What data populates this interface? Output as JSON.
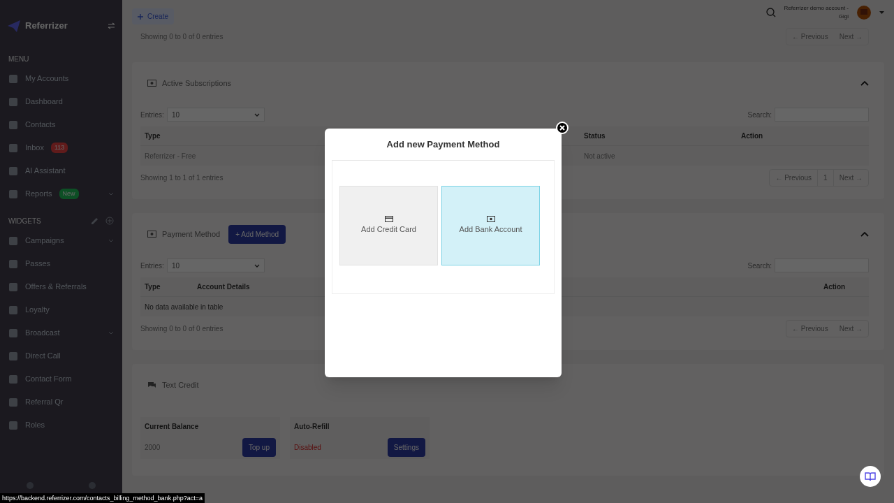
{
  "sidebar": {
    "brand": "Referrizer",
    "sections": [
      {
        "heading": "MENU",
        "items": [
          {
            "label": "My Accounts",
            "expandable": false
          },
          {
            "label": "Dashboard",
            "expandable": false
          },
          {
            "label": "Contacts",
            "expandable": false
          },
          {
            "label": "Inbox",
            "expandable": false,
            "badge": {
              "text": "113",
              "kind": "alert"
            }
          },
          {
            "label": "AI Assistant",
            "expandable": false
          },
          {
            "label": "Reports",
            "expandable": true,
            "badge": {
              "text": "New",
              "kind": "new"
            }
          }
        ]
      },
      {
        "heading": "WIDGETS",
        "items": [
          {
            "label": "Campaigns",
            "expandable": true
          },
          {
            "label": "Passes",
            "expandable": false
          },
          {
            "label": "Offers & Referrals",
            "expandable": false
          },
          {
            "label": "Loyalty",
            "expandable": false
          },
          {
            "label": "Broadcast",
            "expandable": true
          },
          {
            "label": "Direct Call",
            "expandable": false
          },
          {
            "label": "Contact Form",
            "expandable": false
          },
          {
            "label": "Referral Qr",
            "expandable": false
          },
          {
            "label": "Roles",
            "expandable": false
          }
        ]
      }
    ]
  },
  "topbar": {
    "account": "Referrizer demo account -",
    "user": "Gigi"
  },
  "create_button": "Create",
  "top_info": "Showing 0 to 0 of 0 entries",
  "top_pagination": {
    "previous": "← Previous",
    "next": "Next →"
  },
  "subscriptions": {
    "title": "Active Subscriptions",
    "entries_label": "Entries:",
    "entries_value": "10",
    "search_label": "Search:",
    "columns": [
      {
        "label": "Type"
      },
      {
        "label": "Status"
      },
      {
        "label": "Action"
      }
    ],
    "rows": [
      [
        "Referrizer - Free",
        "Not active",
        ""
      ]
    ],
    "info": "Showing 1 to 1 of 1 entries",
    "pagination": {
      "previous": "← Previous",
      "page": "1",
      "next": "Next →"
    }
  },
  "payment": {
    "title": "Payment Method",
    "add_button": "+ Add Method",
    "entries_label": "Entries:",
    "entries_value": "10",
    "search_label": "Search:",
    "columns": [
      {
        "label": "Type"
      },
      {
        "label": "Account Details"
      },
      {
        "label": "Action"
      }
    ],
    "empty": "No data available in table",
    "info": "Showing 0 to 0 of 0 entries",
    "pagination": {
      "previous": "← Previous",
      "next": "Next →"
    }
  },
  "text_credit": {
    "title": "Text Credit",
    "boxes": [
      {
        "title": "Current Balance",
        "value": "2000",
        "status": false,
        "button": "Top up"
      },
      {
        "title": "Auto-Refill",
        "value": "Disabled",
        "status": true,
        "button": "Settings"
      }
    ]
  },
  "modal": {
    "title": "Add new Payment Method",
    "options": [
      {
        "label": "Add Credit Card",
        "kind": "card",
        "selected": false
      },
      {
        "label": "Add Bank Account",
        "kind": "bank",
        "selected": true
      }
    ]
  },
  "status_url": "https://backend.referrizer.com/contacts_billing_method_bank.php?act=a"
}
